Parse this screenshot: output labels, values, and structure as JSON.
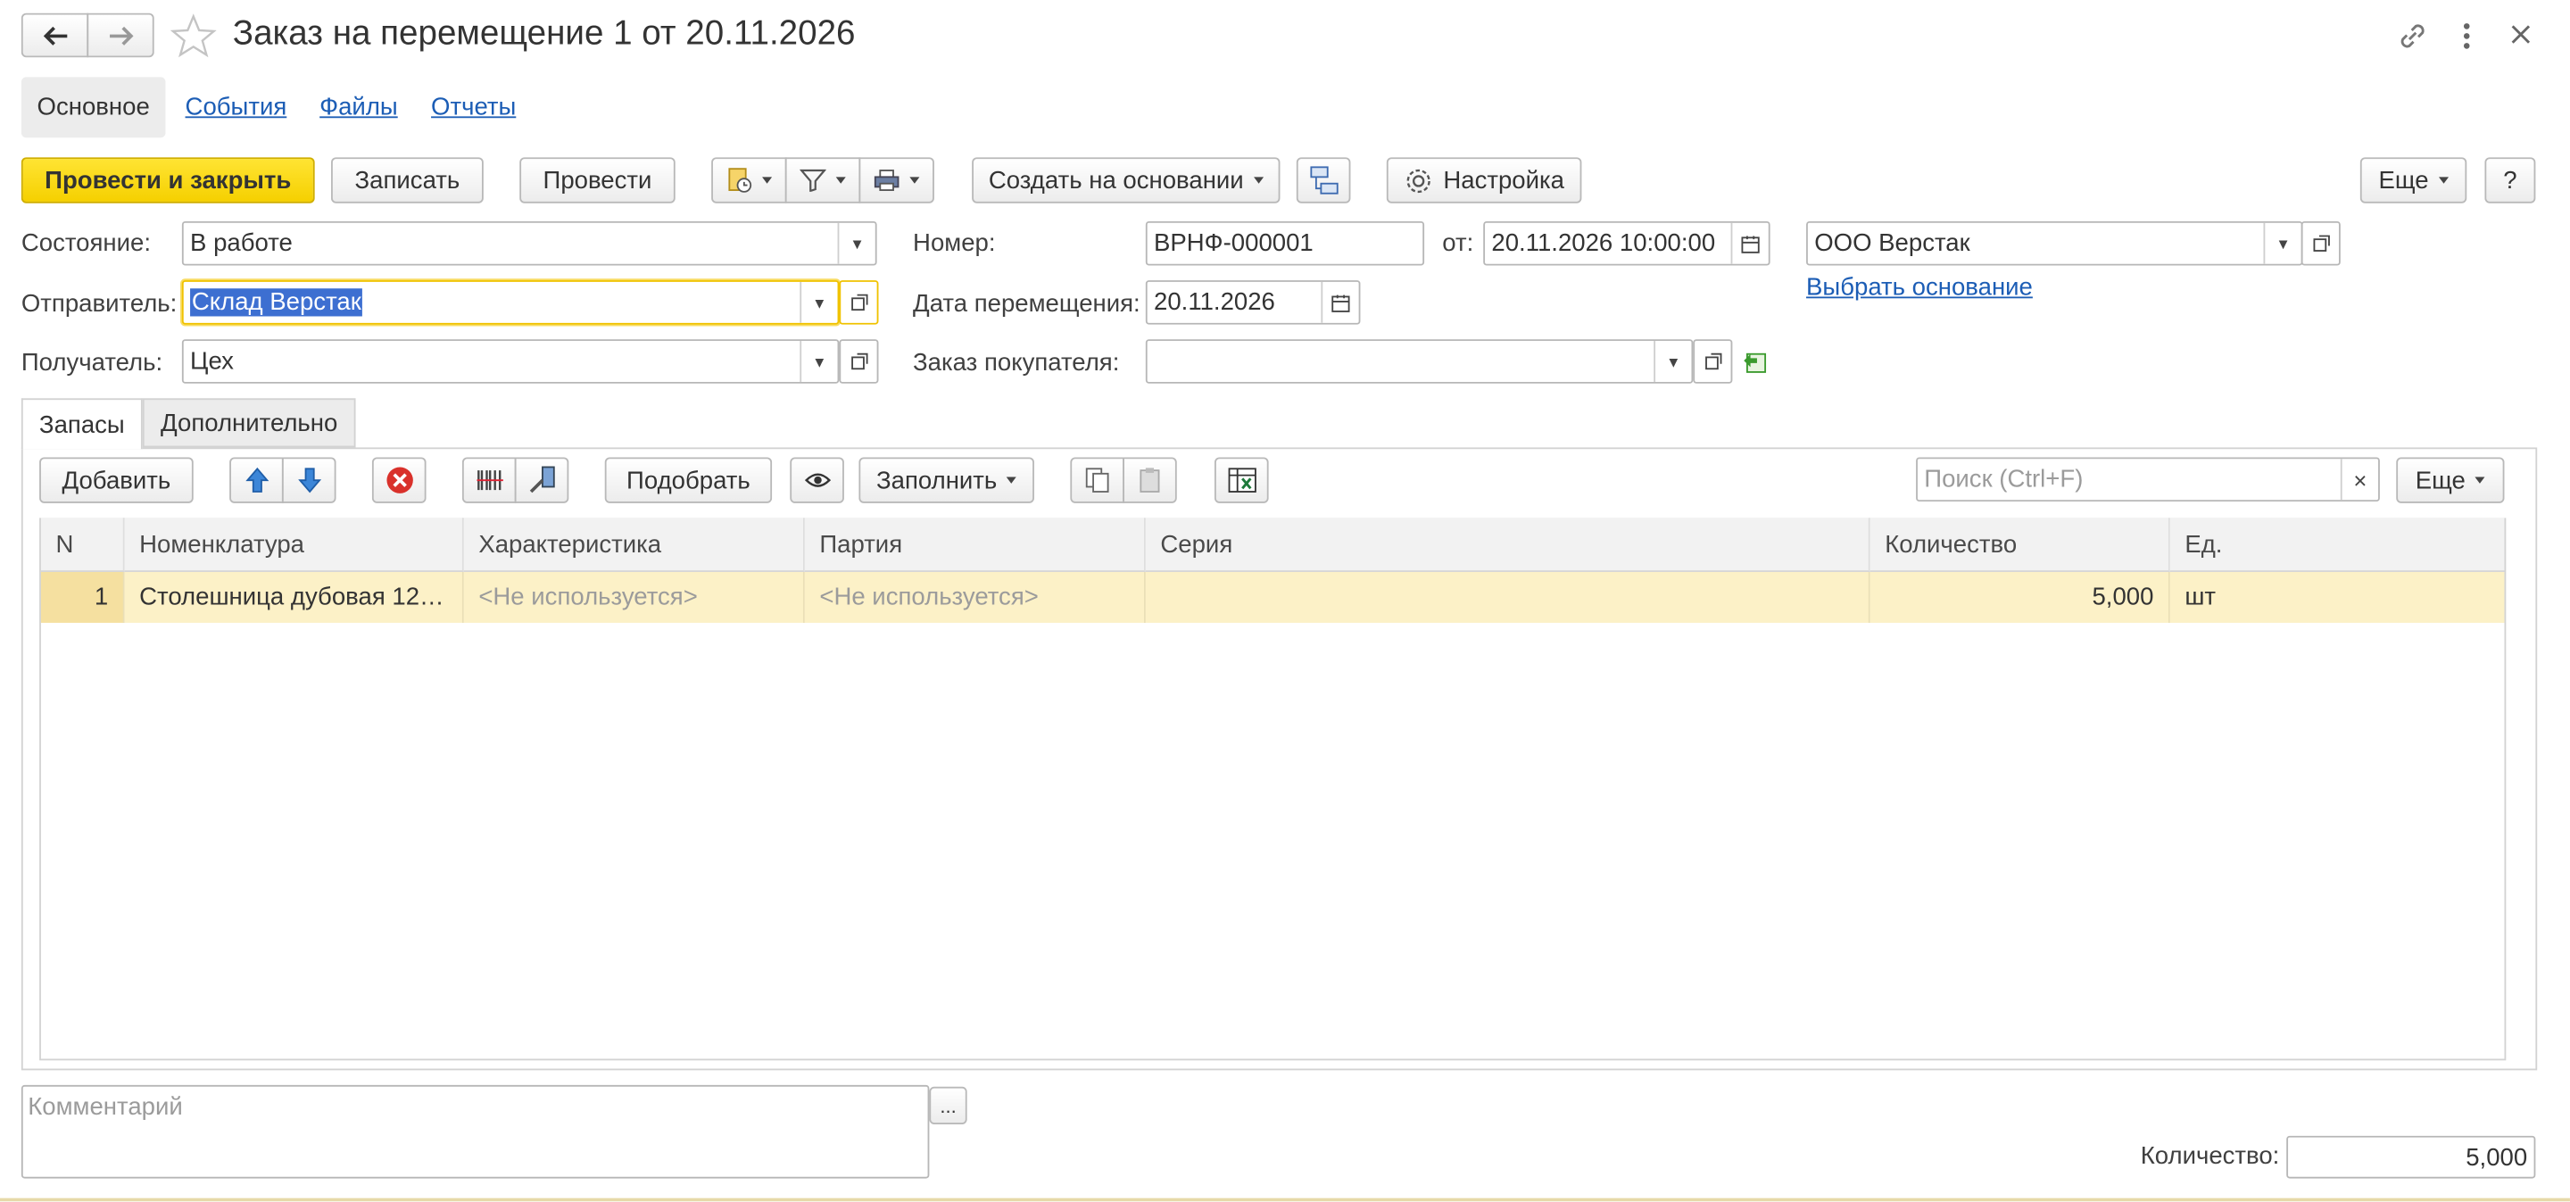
{
  "window": {
    "title": "Заказ на перемещение 1 от 20.11.2026"
  },
  "nav_tabs": [
    {
      "label": "Основное"
    },
    {
      "label": "События"
    },
    {
      "label": "Файлы"
    },
    {
      "label": "Отчеты"
    }
  ],
  "toolbar": {
    "post_close": "Провести и закрыть",
    "save": "Записать",
    "post": "Провести",
    "create_based": "Создать на основании",
    "settings": "Настройка",
    "more": "Еще",
    "help": "?"
  },
  "form": {
    "state_label": "Состояние:",
    "state_value": "В работе",
    "number_label": "Номер:",
    "number_value": "ВРНФ-000001",
    "from_label": "от:",
    "from_value": "20.11.2026 10:00:00",
    "org_value": "ООО Верстак",
    "choose_basis": "Выбрать основание",
    "sender_label": "Отправитель:",
    "sender_value": "Склад Верстак",
    "move_date_label": "Дата перемещения:",
    "move_date_value": "20.11.2026",
    "receiver_label": "Получатель:",
    "receiver_value": "Цех",
    "customer_order_label": "Заказ покупателя:",
    "customer_order_value": ""
  },
  "subtabs": [
    {
      "label": "Запасы"
    },
    {
      "label": "Дополнительно"
    }
  ],
  "table_toolbar": {
    "add": "Добавить",
    "pick": "Подобрать",
    "fill": "Заполнить",
    "search_placeholder": "Поиск (Ctrl+F)",
    "more": "Еще"
  },
  "table": {
    "columns": [
      "N",
      "Номенклатура",
      "Характеристика",
      "Партия",
      "Серия",
      "Количество",
      "Ед."
    ],
    "rows": [
      {
        "n": "1",
        "item": "Столешница дубовая 12…",
        "characteristic": "<Не используется>",
        "batch": "<Не используется>",
        "series": "",
        "quantity": "5,000",
        "unit": "шт"
      }
    ]
  },
  "footer": {
    "comment_placeholder": "Комментарий",
    "comment_more": "...",
    "quantity_label": "Количество:",
    "quantity_value": "5,000"
  },
  "colors": {
    "primary_button": "#f5d000",
    "link": "#1c5db5",
    "selected_row": "#fcf1c7",
    "focus_border": "#f0c200"
  }
}
